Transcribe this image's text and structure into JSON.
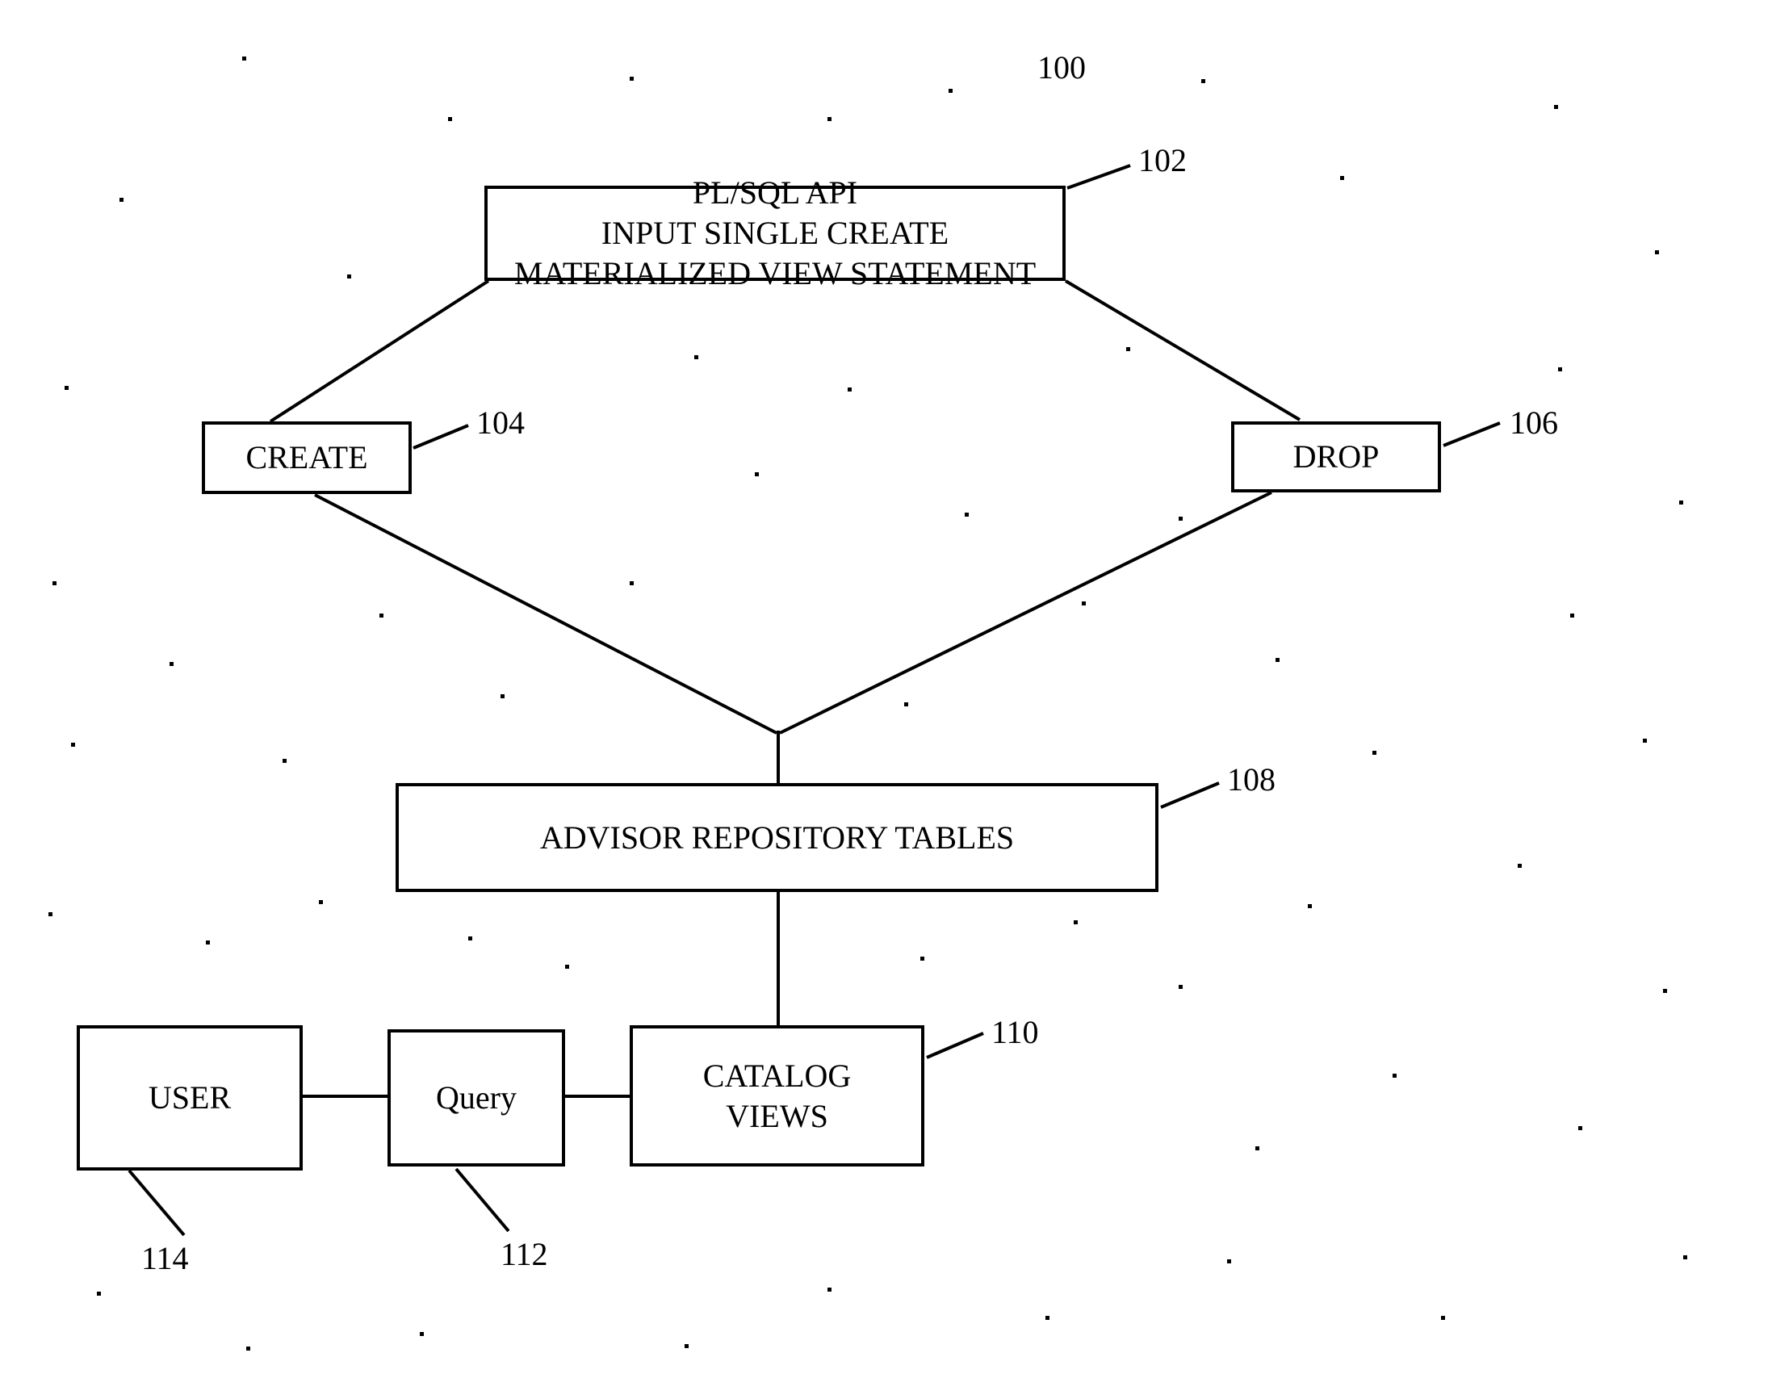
{
  "diagram": {
    "title_ref": "100",
    "nodes": {
      "api": {
        "line1": "PL/SQL API",
        "line2": "INPUT SINGLE CREATE",
        "line3": "MATERIALIZED VIEW STATEMENT",
        "ref": "102"
      },
      "create": {
        "label": "CREATE",
        "ref": "104"
      },
      "drop": {
        "label": "DROP",
        "ref": "106"
      },
      "advisor": {
        "label": "ADVISOR REPOSITORY TABLES",
        "ref": "108"
      },
      "catalog": {
        "line1": "CATALOG",
        "line2": "VIEWS",
        "ref": "110"
      },
      "query": {
        "label": "Query",
        "ref": "112"
      },
      "user": {
        "label": "USER",
        "ref": "114"
      }
    }
  }
}
